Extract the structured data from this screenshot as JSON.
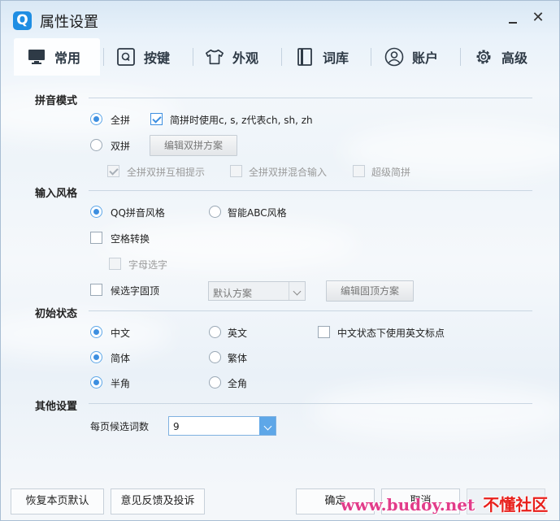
{
  "window": {
    "title": "属性设置",
    "logo_letter": "Q"
  },
  "tabs": [
    {
      "label": "常用",
      "icon": "monitor-icon",
      "active": true
    },
    {
      "label": "按键",
      "icon": "q-key-icon"
    },
    {
      "label": "外观",
      "icon": "tshirt-icon"
    },
    {
      "label": "词库",
      "icon": "book-icon"
    },
    {
      "label": "账户",
      "icon": "user-icon"
    },
    {
      "label": "高级",
      "icon": "gear-icon"
    }
  ],
  "pinyin_mode": {
    "title": "拼音模式",
    "full": "全拼",
    "jianpin": "简拼时使用c, s, z代表ch, sh, zh",
    "shuangpin": "双拼",
    "edit_shuangpin": "编辑双拼方案",
    "hint": "全拼双拼互相提示",
    "mixed": "全拼双拼混合输入",
    "super": "超级简拼",
    "selected": "全拼"
  },
  "input_style": {
    "title": "输入风格",
    "qq": "QQ拼音风格",
    "abc": "智能ABC风格",
    "space_convert": "空格转换",
    "letter_select": "字母选字",
    "pin_top": "候选字固顶",
    "scheme_value": "默认方案",
    "edit_pin": "编辑固顶方案",
    "selected": "QQ拼音风格"
  },
  "initial_state": {
    "title": "初始状态",
    "chinese": "中文",
    "english": "英文",
    "en_punct": "中文状态下使用英文标点",
    "simplified": "简体",
    "traditional": "繁体",
    "half": "半角",
    "full": "全角"
  },
  "other": {
    "title": "其他设置",
    "per_page_label": "每页候选词数",
    "per_page_value": "9"
  },
  "footer": {
    "restore": "恢复本页默认",
    "feedback": "意见反馈及投诉",
    "ok": "确定",
    "cancel": "取消"
  },
  "watermark": {
    "url": "www.budoy.net",
    "brand": "不懂社区"
  },
  "colors": {
    "accent": "#3d8fe0",
    "logo": "#1f8ee3",
    "watermark": "#e23c8a"
  }
}
